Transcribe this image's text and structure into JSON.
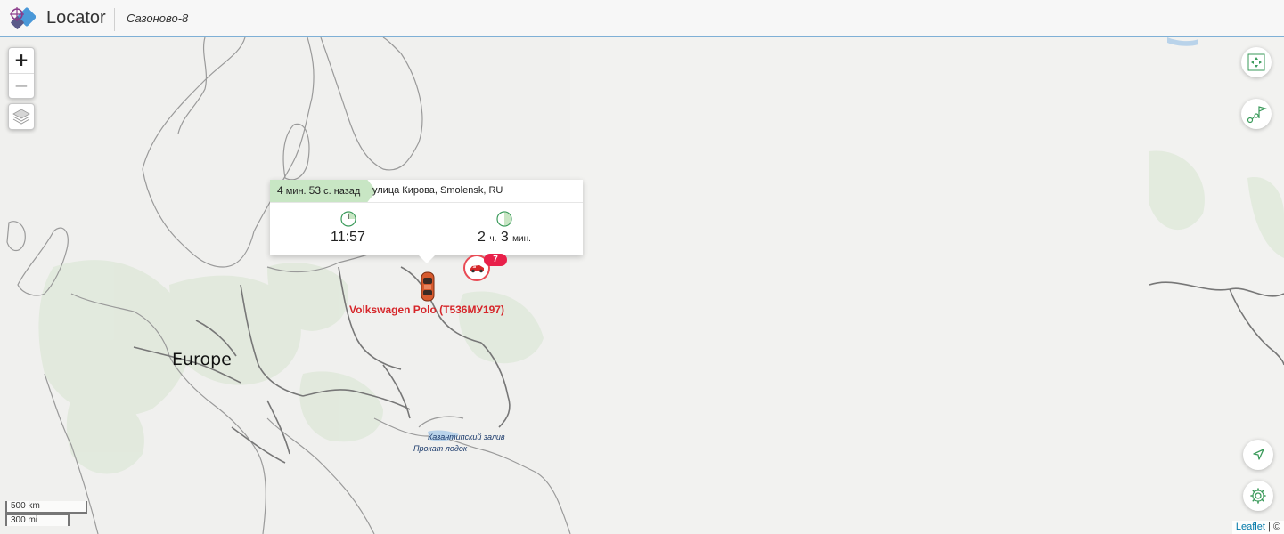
{
  "header": {
    "app_title": "Locator",
    "device_name": "Сазоново-8"
  },
  "map": {
    "zoom_in_label": "+",
    "zoom_out_label": "−",
    "region_label": "Europe",
    "sea_labels": [
      "Казантипский залив",
      "Прокат лодок"
    ]
  },
  "popup": {
    "ago_minutes": "4",
    "ago_min_unit": "мин.",
    "ago_seconds": "53",
    "ago_sec_unit": "с. назад",
    "address": "улица Кирова, Smolensk, RU",
    "time": "11:57",
    "duration_hours": "2",
    "duration_hours_unit": "ч.",
    "duration_minutes": "3",
    "duration_minutes_unit": "мин."
  },
  "vehicle": {
    "name": "Volkswagen Polo (Т536МУ197)",
    "color": "#d6262a"
  },
  "cluster": {
    "count": "7",
    "color": "#e8204a"
  },
  "scale": {
    "km": "500 km",
    "mi": "300 mi"
  },
  "attribution": {
    "link": "Leaflet",
    "rest": "| ©"
  },
  "controls": {
    "right": [
      "fit-bounds-icon",
      "route-flag-icon",
      "locate-arrow-icon",
      "settings-gear-icon"
    ],
    "left": [
      "zoom-in",
      "zoom-out",
      "layers-icon"
    ]
  }
}
